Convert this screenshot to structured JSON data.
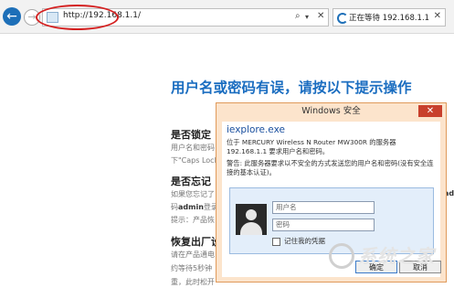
{
  "browser": {
    "url": "http://192.168.1.1/",
    "addr_search_symbol": "⌕",
    "addr_dropdown_symbol": "▾",
    "addr_close_symbol": "✕",
    "tab_title": "正在等待 192.168.1.1",
    "tab_close_symbol": "✕"
  },
  "page": {
    "headline": "用户名或密码有误，请按以下提示操作",
    "sections": [
      {
        "title": "是否锁定",
        "lines": [
          "用户名和密码",
          "下\"Caps Lock"
        ]
      },
      {
        "title": "是否忘记",
        "lines_a": [
          "如果您忘记了",
          "码"
        ],
        "bold_word": "admin",
        "lines_b": [
          "登录",
          "提示：产品恢"
        ]
      },
      {
        "title": "恢复出厂设",
        "lines": [
          "请在产品通电",
          "约等待5秒钟",
          "重，此时松开"
        ]
      }
    ],
    "right_fragment": "adm"
  },
  "dialog": {
    "title": "Windows 安全",
    "close_symbol": "✕",
    "app": "iexplore.exe",
    "message": "位于 MERCURY Wireless N Router MW300R 的服务器 192.168.1.1 要求用户名和密码。",
    "warning": "警告: 此服务器要求以不安全的方式发送您的用户名和密码(没有安全连接的基本认证)。",
    "username_placeholder": "用户名",
    "password_placeholder": "密码",
    "remember_label": "记住我的凭据",
    "ok_label": "确定",
    "cancel_label": "取消"
  },
  "watermark": {
    "text": "系统之家"
  }
}
